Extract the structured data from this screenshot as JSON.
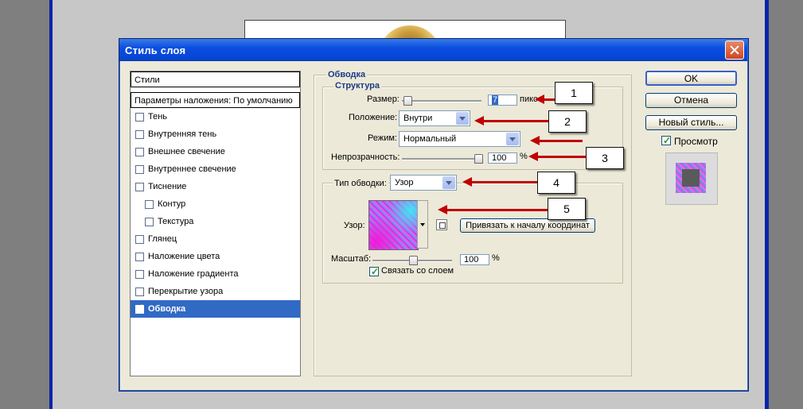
{
  "dialog": {
    "title": "Стиль слоя",
    "style_list": {
      "header": "Стили",
      "blend_options": "Параметры наложения: По умолчанию",
      "items": [
        {
          "label": "Тень",
          "checked": false,
          "sub": false
        },
        {
          "label": "Внутренняя тень",
          "checked": false,
          "sub": false
        },
        {
          "label": "Внешнее свечение",
          "checked": false,
          "sub": false
        },
        {
          "label": "Внутреннее свечение",
          "checked": false,
          "sub": false
        },
        {
          "label": "Тиснение",
          "checked": false,
          "sub": false
        },
        {
          "label": "Контур",
          "checked": false,
          "sub": true
        },
        {
          "label": "Текстура",
          "checked": false,
          "sub": true
        },
        {
          "label": "Глянец",
          "checked": false,
          "sub": false
        },
        {
          "label": "Наложение цвета",
          "checked": false,
          "sub": false
        },
        {
          "label": "Наложение градиента",
          "checked": false,
          "sub": false
        },
        {
          "label": "Перекрытие узора",
          "checked": false,
          "sub": false
        },
        {
          "label": "Обводка",
          "checked": true,
          "sub": false,
          "selected": true
        }
      ]
    },
    "stroke": {
      "group_title": "Обводка",
      "structure_title": "Структура",
      "size_label": "Размер:",
      "size_value": "7",
      "size_unit": "пикс",
      "size_fraction": 0.02,
      "position_label": "Положение:",
      "position_value": "Внутри",
      "blend_mode_label": "Режим:",
      "blend_mode_value": "Нормальный",
      "opacity_label": "Непрозрачность:",
      "opacity_value": "100",
      "opacity_unit": "%",
      "opacity_fraction": 1.0,
      "fill_type_label": "Тип обводки:",
      "fill_type_value": "Узор",
      "pattern_label": "Узор:",
      "snap_origin_label": "Привязать к началу координат",
      "scale_label": "Масштаб:",
      "scale_value": "100",
      "scale_unit": "%",
      "scale_fraction": 0.5,
      "link_layer_label": "Связать со слоем",
      "link_layer_checked": true
    },
    "buttons": {
      "ok": "OK",
      "cancel": "Отмена",
      "new_style": "Новый стиль...",
      "preview_label": "Просмотр",
      "preview_checked": true
    }
  },
  "annotations": [
    "1",
    "2",
    "3",
    "4",
    "5"
  ],
  "colors": {
    "title_bar": "#0a4ee0",
    "selection": "#316ac5",
    "arrow": "#c00000",
    "dialog_bg": "#ece9d8"
  }
}
